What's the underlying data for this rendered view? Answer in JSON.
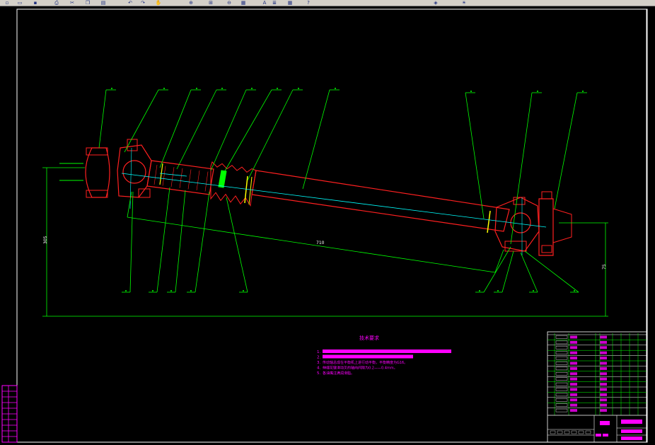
{
  "toolbar": {
    "buttons": [
      {
        "icon": "new-icon"
      },
      {
        "icon": "open-icon"
      },
      {
        "icon": "save-icon"
      },
      {
        "icon": "print-icon"
      },
      {
        "icon": "cut-icon"
      },
      {
        "icon": "copy-icon"
      },
      {
        "icon": "paste-icon"
      },
      {
        "icon": "undo-icon"
      },
      {
        "icon": "redo-icon"
      },
      {
        "icon": "pan-icon"
      },
      {
        "icon": "zoom-icon"
      },
      {
        "icon": "zoom-window-icon"
      },
      {
        "icon": "zoom-previous-icon"
      },
      {
        "icon": "properties-icon"
      },
      {
        "icon": "text-style-icon"
      },
      {
        "icon": "layer-icon"
      },
      {
        "icon": "table-icon"
      },
      {
        "icon": "help-icon"
      },
      {
        "icon": "3d-icon"
      },
      {
        "icon": "light-icon"
      }
    ]
  },
  "colors": {
    "background": "#000000",
    "outline": "#ff2020",
    "leader": "#00ff00",
    "centerline": "#00ffff",
    "text": "#ff00ff",
    "frame": "#ffffff",
    "highlight": "#00ff00",
    "accent_yellow": "#ffff00"
  },
  "drawing": {
    "dimension_length": "710",
    "dimension_left": "305",
    "dimension_right": "75",
    "notes_title": "技术要求",
    "notes": [
      {
        "num": "1."
      },
      {
        "num": "2."
      },
      {
        "num": "3.",
        "text": "传动轴总成在平衡机上进行动平衡，平衡精度为G16。"
      },
      {
        "num": "4.",
        "text": "伸缩花键滑动叉的轴向间隙为0.2——0.4mm。"
      },
      {
        "num": "5.",
        "text": "各油嘴注满润滑脂。"
      }
    ]
  }
}
